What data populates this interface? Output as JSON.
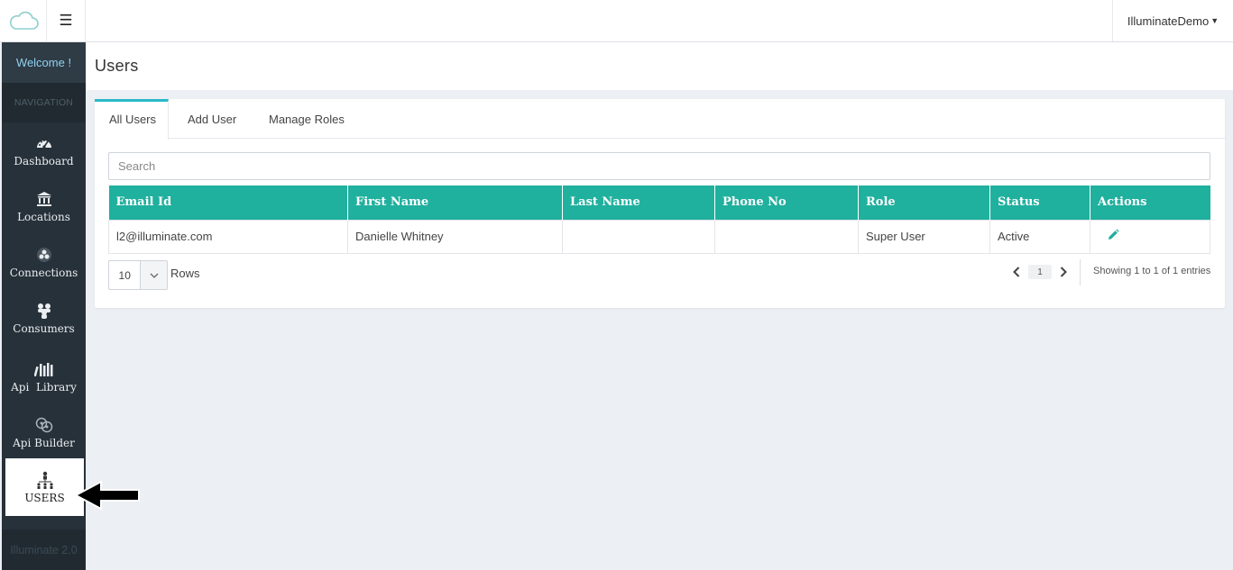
{
  "topbar": {
    "logo_icon": "cloud-icon",
    "menu_icon": "hamburger-icon",
    "user_name": "IlluminateDemo"
  },
  "sidebar": {
    "welcome": "Welcome !",
    "heading": "NAVIGATION",
    "items": [
      {
        "label": "Dashboard",
        "icon": "dashboard-gauge-icon"
      },
      {
        "label": "Locations",
        "icon": "building-icon"
      },
      {
        "label": "Connections",
        "icon": "connections-icon"
      },
      {
        "label": "Consumers",
        "icon": "consumers-icon"
      },
      {
        "label": "Api  Library",
        "icon": "library-icon"
      },
      {
        "label": "Api Builder",
        "icon": "api-builder-icon"
      },
      {
        "label": "USERS",
        "icon": "users-hierarchy-icon",
        "active": true
      }
    ],
    "footer": "Illuminate 2.0"
  },
  "page": {
    "title": "Users"
  },
  "tabs": [
    {
      "label": "All Users",
      "active": true
    },
    {
      "label": "Add User",
      "active": false
    },
    {
      "label": "Manage Roles",
      "active": false
    }
  ],
  "search": {
    "placeholder": "Search",
    "value": ""
  },
  "table": {
    "columns": [
      "Email Id",
      "First Name",
      "Last Name",
      "Phone No",
      "Role",
      "Status",
      "Actions"
    ],
    "rows": [
      {
        "email": "l2@illuminate.com",
        "first_name": "Danielle Whitney",
        "last_name": "",
        "phone": "",
        "role": "Super User",
        "status": "Active",
        "action_icon": "pencil-icon"
      }
    ]
  },
  "footer": {
    "rows_value": "10",
    "rows_label": "Rows",
    "current_page": "1",
    "entries": "Showing 1 to 1 of 1 entries"
  },
  "colors": {
    "header_teal": "#20b09e",
    "tab_accent": "#29b9c9",
    "sidebar_bg": "#27313a"
  }
}
